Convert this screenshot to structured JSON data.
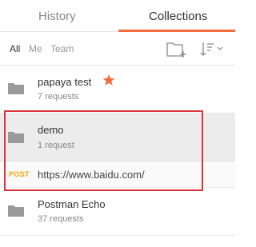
{
  "tabs": {
    "history_label": "History",
    "collections_label": "Collections"
  },
  "filters": {
    "all": "All",
    "me": "Me",
    "team": "Team"
  },
  "collections": [
    {
      "name": "papaya test",
      "count": "7 requests",
      "starred": true
    },
    {
      "name": "demo",
      "count": "1 request",
      "selected": true,
      "requests": [
        {
          "method": "POST",
          "url": "https://www.baidu.com/"
        }
      ]
    },
    {
      "name": "Postman Echo",
      "count": "37 requests"
    }
  ],
  "colors": {
    "accent": "#f26b3a",
    "star": "#f26b3a",
    "post_method": "#f0a500",
    "highlight_border": "#d9363e"
  }
}
